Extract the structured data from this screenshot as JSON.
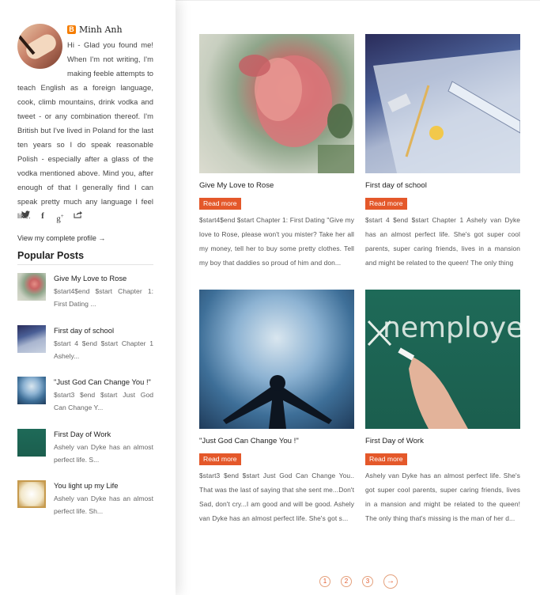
{
  "profile": {
    "name": "Minh Anh",
    "bio": "Hi - Glad you found me! When I'm not writing, I'm making feeble attempts to teach English as a foreign language, cook, climb mountains, drink vodka and tweet - or any combination thereof. I'm British but I've lived in Poland for the last ten years so I do speak reasonable Polish - especially after a glass of the vodka mentioned above. Mind you, after enough of that I generally find I can speak pretty much any language I feel like.",
    "view_profile": "View my complete profile →",
    "social_icons": [
      "twitter-icon",
      "facebook-icon",
      "google-plus-icon",
      "share-icon"
    ]
  },
  "popular": {
    "title": "Popular Posts",
    "items": [
      {
        "title": "Give My Love to Rose",
        "snippet": "$start4$end $start Chapter 1: First Dating ..."
      },
      {
        "title": "First day of school",
        "snippet": "$start 4 $end $start Chapter 1 Ashely..."
      },
      {
        "title": "\"Just God Can Change You !\"",
        "snippet": "$start3 $end $start Just God Can Change Y..."
      },
      {
        "title": "First Day of Work",
        "snippet": "Ashely van Dyke has an almost perfect life. S..."
      },
      {
        "title": "You light up my Life",
        "snippet": "Ashely van Dyke has an almost perfect life. Sh..."
      }
    ]
  },
  "posts": [
    {
      "title": "Give My Love to Rose",
      "read_more": "Read more",
      "excerpt": "$start4$end $start Chapter 1: First Dating \"Give my love to Rose, please won't you mister? Take her all my money, tell her to buy some pretty clothes. Tell my boy that daddies so proud of him and don..."
    },
    {
      "title": "First day of school",
      "read_more": "Read more",
      "excerpt": "$start 4 $end $start Chapter 1 Ashely van Dyke has an almost perfect life. She's got super cool parents, super caring friends, lives in a mansion and might be related to the queen! The only thing"
    },
    {
      "title": "\"Just God Can Change You !\"",
      "read_more": "Read more",
      "excerpt": "$start3 $end $start Just God Can Change You.. That was the last of saying that she sent me...Don't Sad, don't cry...I am good and will be good. Ashely van Dyke has an almost perfect life. She's got s..."
    },
    {
      "title": "First Day of Work",
      "read_more": "Read more",
      "excerpt": "Ashely van Dyke has an almost perfect life. She's got super cool parents, super caring friends, lives in a mansion and might be related to the queen! The only thing that's missing is the man of her d..."
    }
  ],
  "unemploy_text": "nemploye",
  "pagination": {
    "pages": [
      "1",
      "2",
      "3"
    ],
    "next": "→"
  },
  "colors": {
    "accent": "#e4582a"
  }
}
